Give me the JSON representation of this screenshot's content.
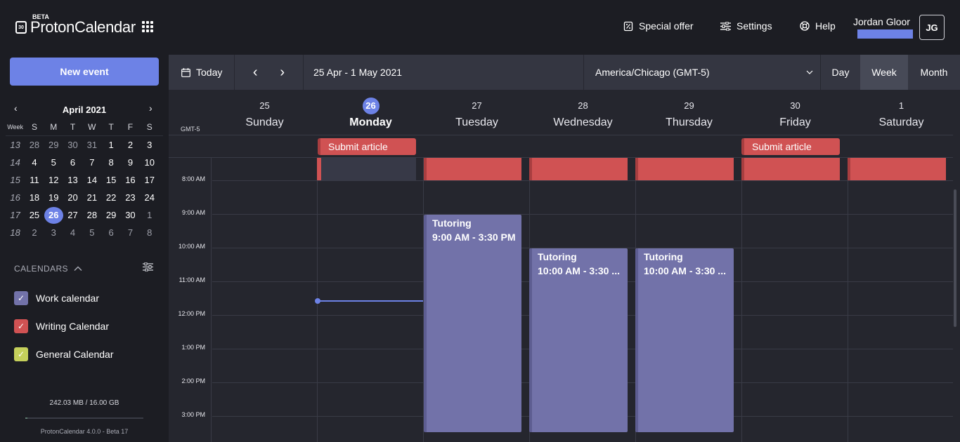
{
  "app": {
    "name": "ProtonCalendar",
    "badge": "BETA",
    "logo_day": "30"
  },
  "header": {
    "special_offer": "Special offer",
    "settings": "Settings",
    "help": "Help",
    "user_name": "Jordan Gloor",
    "avatar_initials": "JG"
  },
  "sidebar": {
    "new_event": "New event",
    "mini_calendar": {
      "title": "April 2021",
      "prev": "‹",
      "next": "›",
      "week_label": "Week",
      "weekdays": [
        "S",
        "M",
        "T",
        "W",
        "T",
        "F",
        "S"
      ],
      "weeks": [
        {
          "wk": "13",
          "days": [
            "28",
            "29",
            "30",
            "31",
            "1",
            "2",
            "3"
          ],
          "muted": [
            true,
            true,
            true,
            true,
            false,
            false,
            false
          ]
        },
        {
          "wk": "14",
          "days": [
            "4",
            "5",
            "6",
            "7",
            "8",
            "9",
            "10"
          ],
          "muted": [
            false,
            false,
            false,
            false,
            false,
            false,
            false
          ]
        },
        {
          "wk": "15",
          "days": [
            "11",
            "12",
            "13",
            "14",
            "15",
            "16",
            "17"
          ],
          "muted": [
            false,
            false,
            false,
            false,
            false,
            false,
            false
          ]
        },
        {
          "wk": "16",
          "days": [
            "18",
            "19",
            "20",
            "21",
            "22",
            "23",
            "24"
          ],
          "muted": [
            false,
            false,
            false,
            false,
            false,
            false,
            false
          ]
        },
        {
          "wk": "17",
          "days": [
            "25",
            "26",
            "27",
            "28",
            "29",
            "30",
            "1"
          ],
          "muted": [
            false,
            false,
            false,
            false,
            false,
            false,
            true
          ]
        },
        {
          "wk": "18",
          "days": [
            "2",
            "3",
            "4",
            "5",
            "6",
            "7",
            "8"
          ],
          "muted": [
            true,
            true,
            true,
            true,
            true,
            true,
            true
          ]
        }
      ],
      "today": "26"
    },
    "calendars_heading": "CALENDARS",
    "calendars": [
      {
        "name": "Work calendar",
        "color": "#7272a9"
      },
      {
        "name": "Writing Calendar",
        "color": "#d05253"
      },
      {
        "name": "General Calendar",
        "color": "#c5d05b"
      }
    ],
    "storage": "242.03 MB / 16.00 GB",
    "storage_used_fraction": 0.015,
    "version": "ProtonCalendar 4.0.0 - Beta 17"
  },
  "toolbar": {
    "today": "Today",
    "prev": "‹",
    "next": "›",
    "range": "25 Apr - 1 May 2021",
    "timezone": "America/Chicago (GMT-5)",
    "views": [
      "Day",
      "Week",
      "Month"
    ],
    "active_view": "Week"
  },
  "week": {
    "timezone_label": "GMT-5",
    "days": [
      {
        "num": "25",
        "name": "Sunday"
      },
      {
        "num": "26",
        "name": "Monday"
      },
      {
        "num": "27",
        "name": "Tuesday"
      },
      {
        "num": "28",
        "name": "Wednesday"
      },
      {
        "num": "29",
        "name": "Thursday"
      },
      {
        "num": "30",
        "name": "Friday"
      },
      {
        "num": "1",
        "name": "Saturday"
      }
    ],
    "today_index": 1,
    "hours": [
      "8:00 AM",
      "9:00 AM",
      "10:00 AM",
      "11:00 AM",
      "12:00 PM",
      "1:00 PM",
      "2:00 PM",
      "3:00 PM"
    ],
    "all_day_events": [
      {
        "title": "Submit article",
        "day": "Monday"
      },
      {
        "title": "Submit article",
        "day": "Friday"
      }
    ],
    "events": [
      {
        "title": "Tutoring",
        "time": "9:00 AM - 3:30 PM",
        "day": "Tuesday"
      },
      {
        "title": "Tutoring",
        "time": "10:00 AM - 3:30 ...",
        "day": "Wednesday"
      },
      {
        "title": "Tutoring",
        "time": "10:00 AM - 3:30 ...",
        "day": "Thursday"
      }
    ]
  },
  "colors": {
    "accent": "#6d82e6",
    "event_red": "#d05253",
    "event_purple": "#7272a9"
  }
}
